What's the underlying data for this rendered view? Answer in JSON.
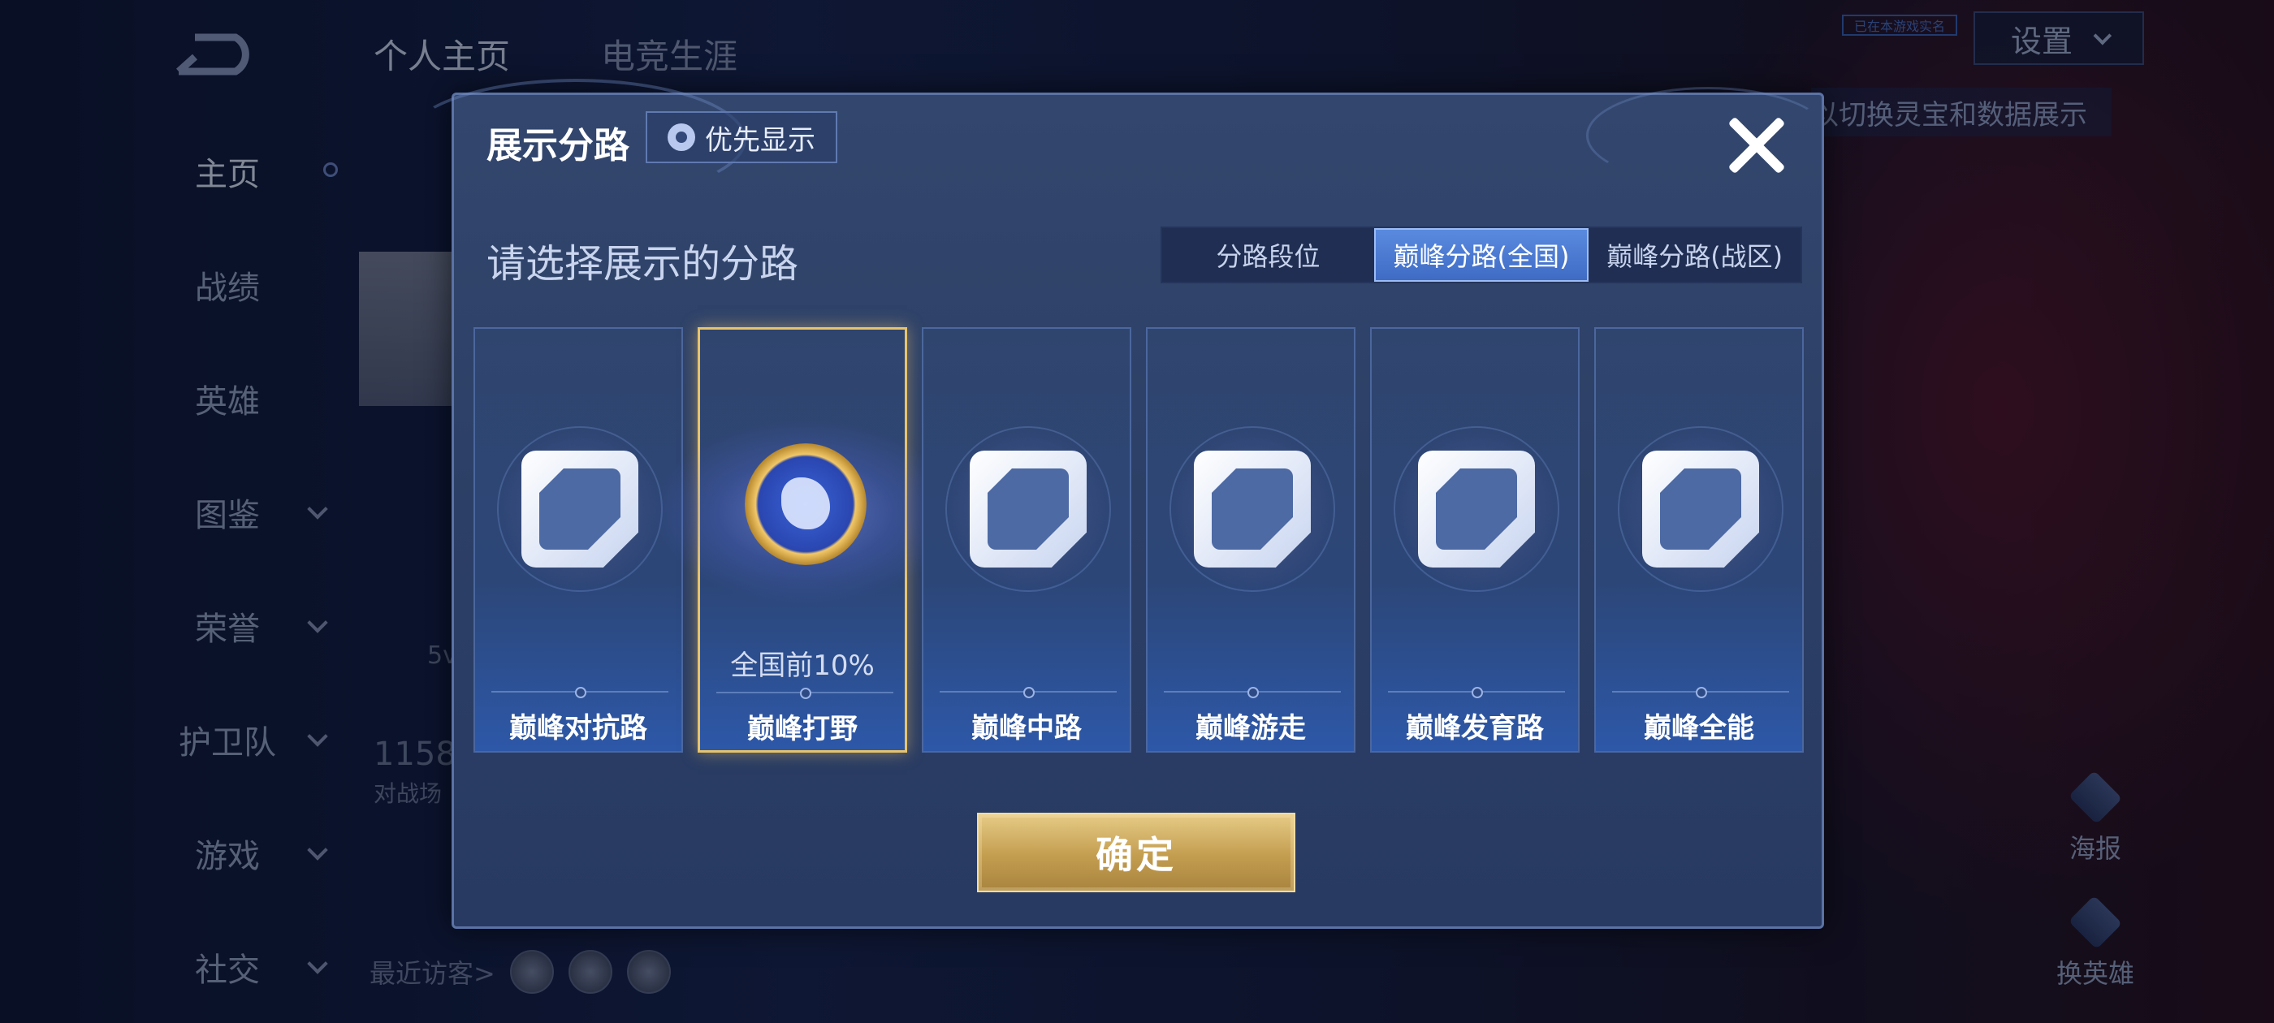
{
  "background": {
    "tabs": [
      "个人主页",
      "电竞生涯"
    ],
    "sidebar": [
      "主页",
      "战绩",
      "英雄",
      "图鉴",
      "荣誉",
      "护卫队",
      "游戏",
      "社交"
    ],
    "settings_label": "设置",
    "hint_text": "以切换灵宝和数据展示",
    "badge_text": "已在本游戏实名",
    "right_buttons": [
      "海报",
      "换英雄"
    ],
    "peek_texts": [
      "5v",
      "1158",
      "对战场"
    ],
    "recent_visitors_label": "最近访客>"
  },
  "dialog": {
    "title": "展示分路",
    "priority_label": "优先显示",
    "prompt": "请选择展示的分路",
    "segments": [
      "分路段位",
      "巅峰分路(全国)",
      "巅峰分路(战区)"
    ],
    "active_segment": "巅峰分路(全国)",
    "cards": [
      {
        "label": "巅峰对抗路",
        "icon": "clash-lane-icon"
      },
      {
        "label": "巅峰打野",
        "icon": "jungle-medal-icon",
        "rank": "全国前10%",
        "selected": true
      },
      {
        "label": "巅峰中路",
        "icon": "mid-lane-icon"
      },
      {
        "label": "巅峰游走",
        "icon": "roam-icon"
      },
      {
        "label": "巅峰发育路",
        "icon": "farm-lane-icon"
      },
      {
        "label": "巅峰全能",
        "icon": "all-round-icon"
      }
    ],
    "confirm_label": "确定"
  },
  "colors": {
    "accent_blue": "#3f6bc4",
    "gold": "#c39d4f",
    "dialog_bg": "#2c3f66"
  }
}
